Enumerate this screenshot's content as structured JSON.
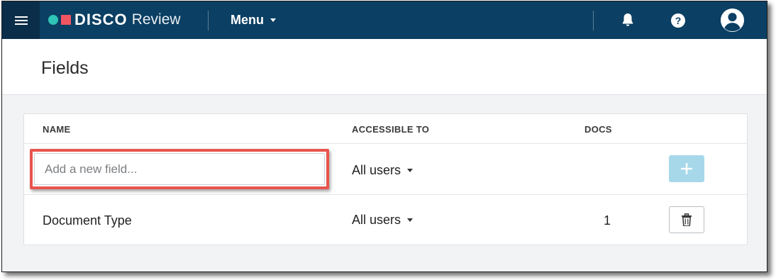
{
  "app": {
    "brand": "DISCO",
    "product": "Review",
    "menu_label": "Menu"
  },
  "page": {
    "title": "Fields"
  },
  "table": {
    "columns": {
      "name": "NAME",
      "accessible_to": "ACCESSIBLE TO",
      "docs": "DOCS"
    },
    "new_field": {
      "placeholder": "Add a new field...",
      "accessible_to": "All users"
    },
    "rows": [
      {
        "name": "Document Type",
        "accessible_to": "All users",
        "docs": "1"
      }
    ]
  },
  "colors": {
    "topbar": "#0b3f63",
    "hamburger_bg": "#0a2e49",
    "logo_dot": "#2ec4b6",
    "logo_square": "#f25562",
    "highlight": "#e8554e",
    "add_button": "#a6d8ea"
  },
  "icons": [
    "hamburger-icon",
    "bell-icon",
    "help-icon",
    "user-avatar-icon",
    "plus-icon",
    "trash-icon",
    "chevron-down-icon"
  ]
}
